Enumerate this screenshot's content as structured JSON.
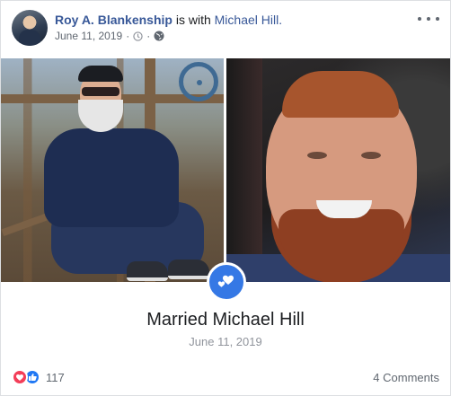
{
  "post": {
    "author": "Roy A. Blankenship",
    "with_text": "is with",
    "tagged": "Michael Hill.",
    "date": "June 11, 2019",
    "icons": [
      "clock-icon",
      "globe-icon",
      "more-options-icon"
    ]
  },
  "event": {
    "title": "Married Michael Hill",
    "date": "June 11, 2019",
    "icon": "hearts-icon",
    "icon_color": "#3578e5"
  },
  "footer": {
    "reaction_count": "117",
    "comments_label": "4 Comments",
    "reaction_icons": [
      "love-icon",
      "like-icon"
    ]
  },
  "colors": {
    "link": "#385898",
    "secondary": "#606770",
    "love": "#f33e58",
    "like": "#2078f4"
  }
}
